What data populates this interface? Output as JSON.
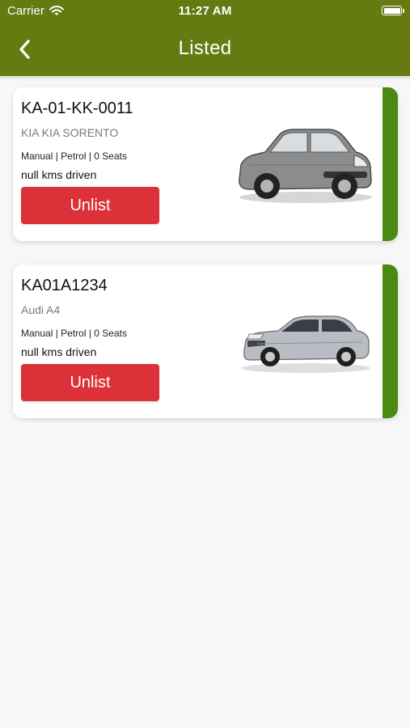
{
  "status_bar": {
    "carrier": "Carrier",
    "time": "11:27 AM"
  },
  "header": {
    "title": "Listed",
    "back_icon": "chevron-left-icon",
    "background_color": "#667a12"
  },
  "listings": [
    {
      "plate": "KA-01-KK-0011",
      "model": "KIA KIA SORENTO",
      "specs": "Manual | Petrol | 0 Seats",
      "kms": "null kms driven",
      "unlist_label": "Unlist",
      "car_color": "#8c8c8c",
      "car_style": "hatchback"
    },
    {
      "plate": "KA01A1234",
      "model": "Audi A4",
      "specs": "Manual | Petrol | 0 Seats",
      "kms": "null kms driven",
      "unlist_label": "Unlist",
      "car_color": "#b9bcc2",
      "car_style": "sedan"
    }
  ],
  "colors": {
    "accent": "#4b8a12",
    "unlist": "#dc3136"
  }
}
